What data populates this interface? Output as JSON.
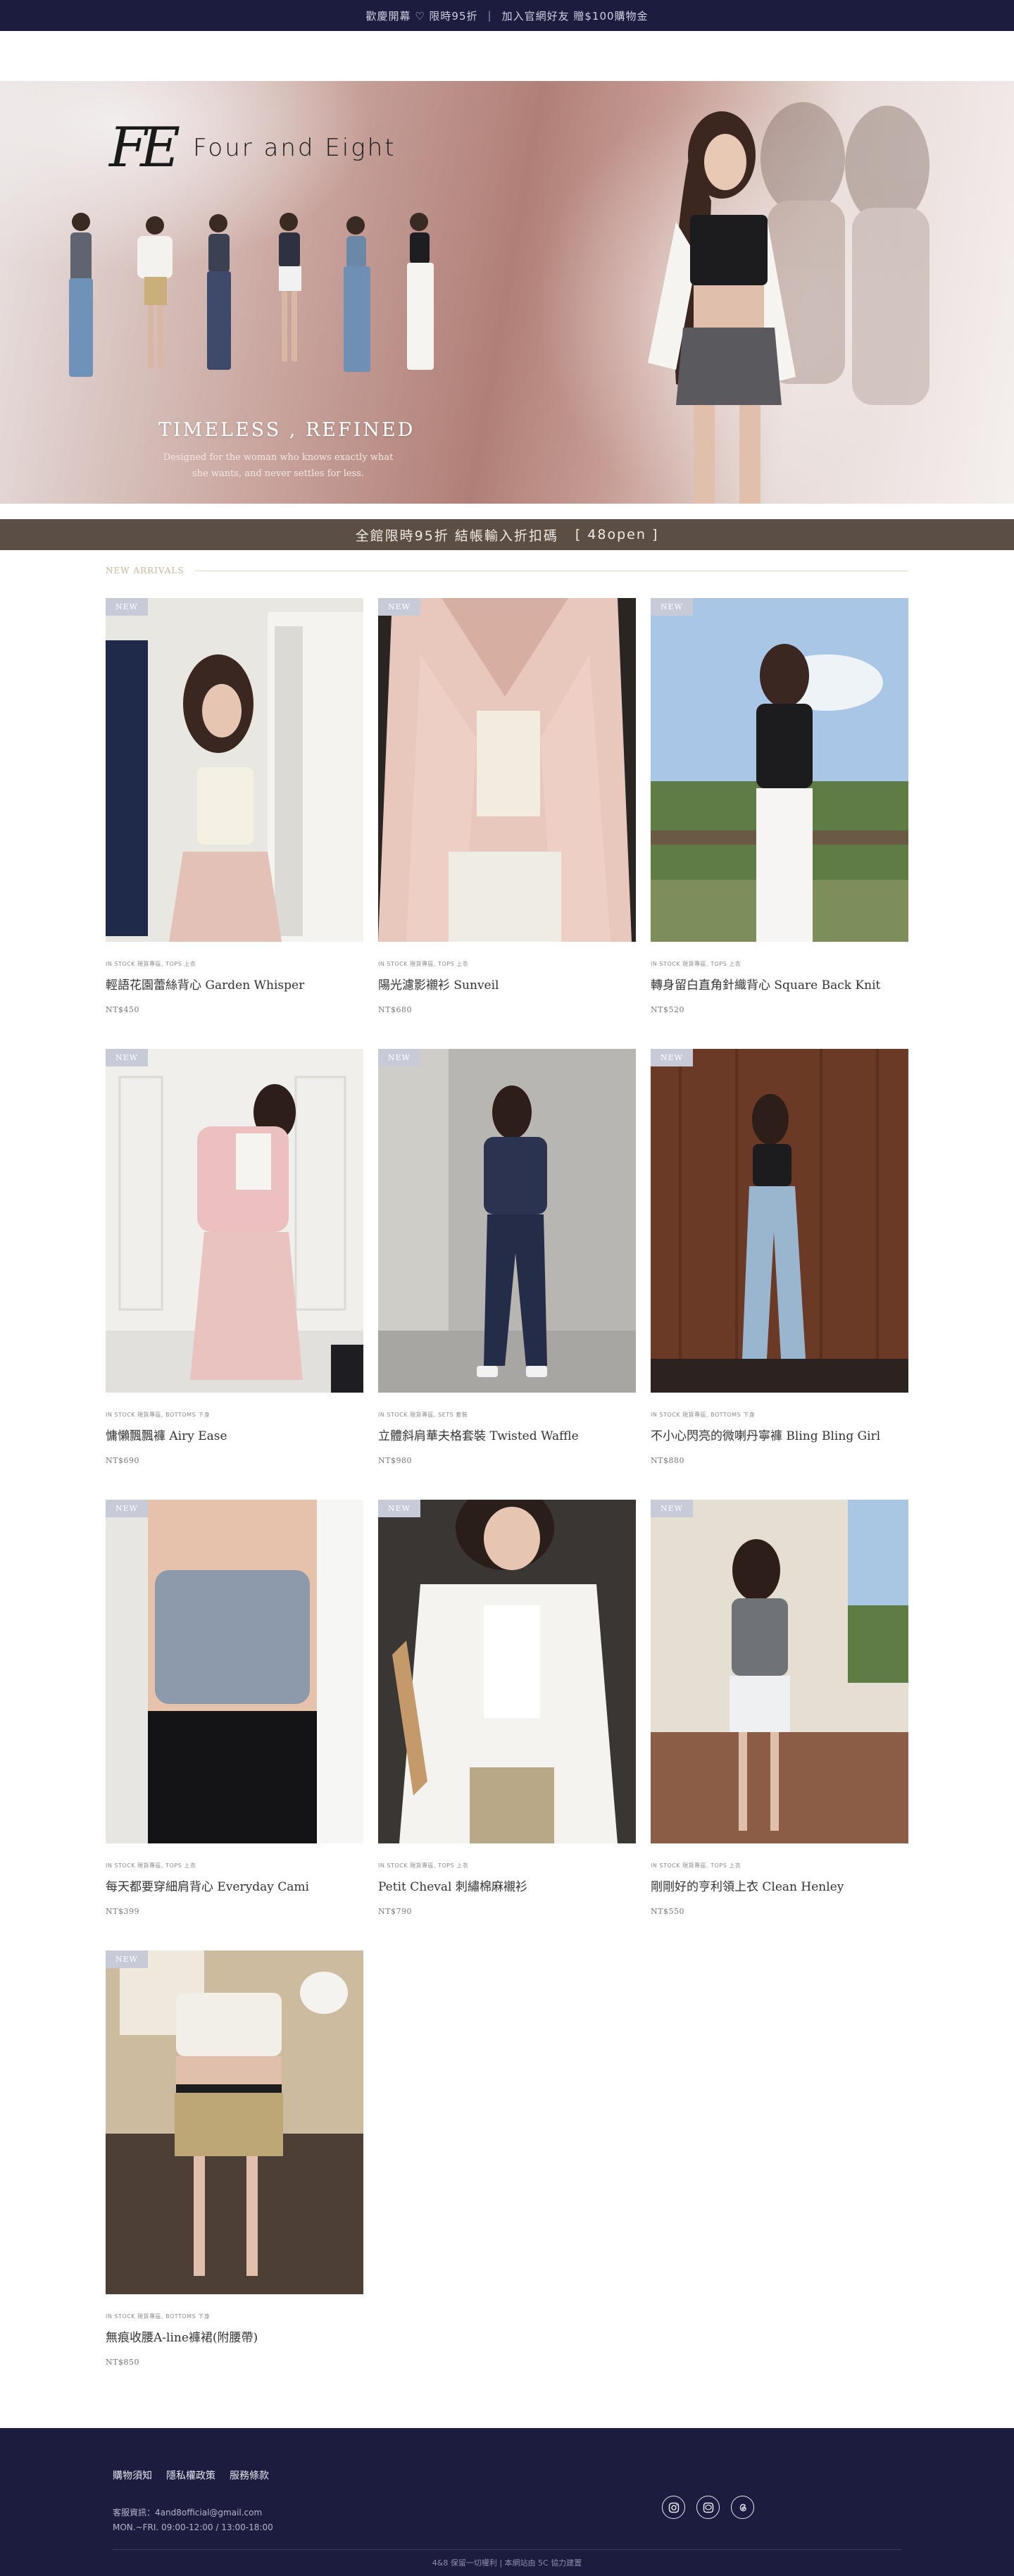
{
  "announcement": {
    "left": "歡慶開幕 ♡ 限時95折",
    "separator": "|",
    "right": "加入官網好友 贈$100購物金"
  },
  "hero": {
    "monogram": "FE",
    "brand": "Four and Eight",
    "tagline": "TIMELESS , REFINED",
    "subline": "Designed for the woman who knows exactly what she wants, and never settles for less."
  },
  "promo": {
    "text": "全館限時95折 結帳輸入折扣碼",
    "code": "[ 48open ]"
  },
  "section": {
    "title": "NEW ARRIVALS"
  },
  "products": [
    {
      "badge": "NEW",
      "category": "IN STOCK 現貨專區, TOPS 上衣",
      "name": "輕語花園蕾絲背心 Garden Whisper",
      "price": "NT$450"
    },
    {
      "badge": "NEW",
      "category": "IN STOCK 現貨專區, TOPS 上衣",
      "name": "陽光濾影襯衫 Sunveil",
      "price": "NT$680"
    },
    {
      "badge": "NEW",
      "category": "IN STOCK 現貨專區, TOPS 上衣",
      "name": "轉身留白直角針織背心 Square Back Knit",
      "price": "NT$520"
    },
    {
      "badge": "NEW",
      "category": "IN STOCK 現貨專區, BOTTOMS 下身",
      "name": "慵懶飄飄褲 Airy Ease",
      "price": "NT$690"
    },
    {
      "badge": "NEW",
      "category": "IN STOCK 現貨專區, SETS 套裝",
      "name": "立體斜肩華夫格套裝 Twisted Waffle",
      "price": "NT$980"
    },
    {
      "badge": "NEW",
      "category": "IN STOCK 現貨專區, BOTTOMS 下身",
      "name": "不小心閃亮的微喇丹寧褲 Bling Bling Girl",
      "price": "NT$880"
    },
    {
      "badge": "NEW",
      "category": "IN STOCK 現貨專區, TOPS 上衣",
      "name": "每天都要穿細肩背心 Everyday Cami",
      "price": "NT$399"
    },
    {
      "badge": "NEW",
      "category": "IN STOCK 現貨專區, TOPS 上衣",
      "name": "Petit Cheval 刺繡棉麻襯衫",
      "price": "NT$790"
    },
    {
      "badge": "NEW",
      "category": "IN STOCK 現貨專區, TOPS 上衣",
      "name": "剛剛好的亨利領上衣 Clean Henley",
      "price": "NT$550"
    },
    {
      "badge": "NEW",
      "category": "IN STOCK 現貨專區, BOTTOMS 下身",
      "name": "無痕收腰A-line褲裙(附腰帶)",
      "price": "NT$850"
    }
  ],
  "footer": {
    "links": [
      "購物須知",
      "隱私權政策",
      "服務條款"
    ],
    "service_email": "客服資訊：4and8official@gmail.com",
    "service_hours": "MON.~FRI. 09:00-12:00 / 13:00-18:00",
    "social": [
      "instagram-icon",
      "line-icon",
      "threads-icon"
    ],
    "copyright": "4&8 保留一切權利 | 本網站由 5C 協力建置"
  },
  "colors": {
    "navy": "#1c1c3e",
    "promo_brown": "#5b4f45",
    "badge": "#c7cbd8"
  }
}
